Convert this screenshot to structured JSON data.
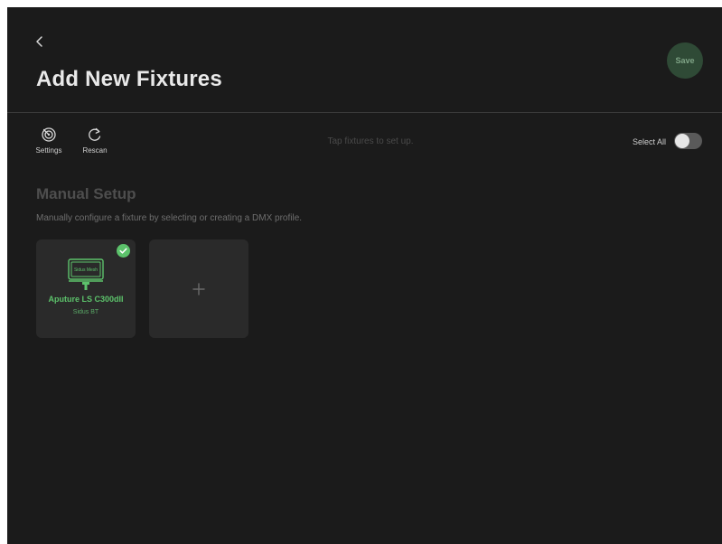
{
  "header": {
    "back_icon": "chevron-left-icon",
    "title": "Add New Fixtures",
    "save_label": "Save"
  },
  "toolbar": {
    "settings": {
      "icon": "radar-icon",
      "label": "Settings"
    },
    "rescan": {
      "icon": "refresh-icon",
      "label": "Rescan"
    },
    "hint": "Tap fixtures to set up.",
    "select_all_label": "Select All",
    "select_all_on": false
  },
  "manual_setup": {
    "title": "Manual Setup",
    "description": "Manually configure a fixture by selecting or creating a DMX profile.",
    "fixtures": [
      {
        "name": "Aputure LS C300dII",
        "protocol": "Sidus BT",
        "image_text": "Sidus Mesh",
        "selected": true,
        "icon": "check-icon"
      }
    ],
    "add_icon": "plus-icon"
  },
  "colors": {
    "background": "#1b1b1b",
    "card": "#2a2a2a",
    "accent_green": "#5cc26b",
    "save_button": "#2f4a36"
  }
}
